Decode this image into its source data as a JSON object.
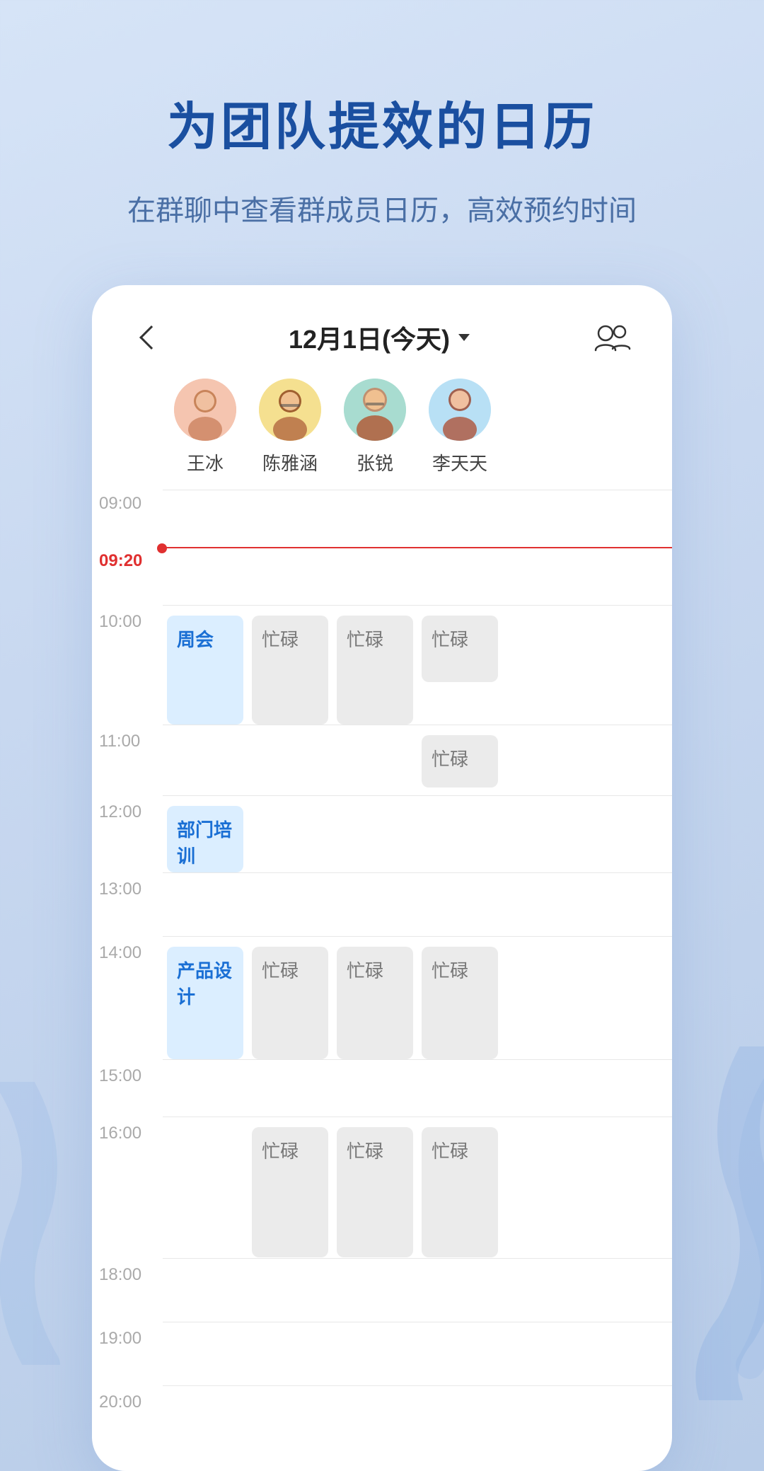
{
  "hero": {
    "title": "为团队提效的日历",
    "subtitle": "在群聊中查看群成员日历，高效预约时间"
  },
  "header": {
    "date": "12月1日(今天)",
    "back_label": "back",
    "group_label": "group"
  },
  "members": [
    {
      "name": "王冰",
      "avatar_color": "#f8d0c8",
      "avatar_label": "👩"
    },
    {
      "name": "陈雅涵",
      "avatar_color": "#f5e0a0",
      "avatar_label": "👩‍🦱"
    },
    {
      "name": "张锐",
      "avatar_color": "#c8e8e0",
      "avatar_label": "👨‍🦲"
    },
    {
      "name": "李天天",
      "avatar_color": "#c8e8f5",
      "avatar_label": "👩"
    }
  ],
  "schedule": {
    "time_slots": [
      {
        "time": "09:00",
        "is_current": false,
        "events": [
          null,
          null,
          null,
          null
        ]
      },
      {
        "time": "09:20",
        "is_current": true,
        "events": [
          null,
          null,
          null,
          null
        ]
      },
      {
        "time": "10:00",
        "is_current": false,
        "events": [
          {
            "label": "周会",
            "type": "blue",
            "span": 2
          },
          {
            "label": "忙碌",
            "type": "gray",
            "span": 2
          },
          {
            "label": "忙碌",
            "type": "gray",
            "span": 2
          },
          {
            "label": "忙碌",
            "type": "gray",
            "span": 2
          }
        ]
      },
      {
        "time": "11:00",
        "is_current": false,
        "events": [
          null,
          "cont",
          "cont",
          null
        ]
      },
      {
        "time": "12:00",
        "is_current": false,
        "events": [
          {
            "label": "部门培训",
            "type": "blue",
            "span": 1.5
          },
          null,
          null,
          {
            "label": "忙碌",
            "type": "gray",
            "span": 1
          }
        ]
      },
      {
        "time": "13:00",
        "is_current": false,
        "events": [
          null,
          null,
          null,
          null
        ]
      },
      {
        "time": "14:00",
        "is_current": false,
        "events": [
          {
            "label": "产品设计",
            "type": "blue",
            "span": 2
          },
          {
            "label": "忙碌",
            "type": "gray",
            "span": 2
          },
          {
            "label": "忙碌",
            "type": "gray",
            "span": 2
          },
          {
            "label": "忙碌",
            "type": "gray",
            "span": 2
          }
        ]
      },
      {
        "time": "15:00",
        "is_current": false,
        "events": [
          null,
          null,
          null,
          null
        ]
      },
      {
        "time": "16:00",
        "is_current": false,
        "events": [
          null,
          {
            "label": "忙碌",
            "type": "gray",
            "span": 2.5
          },
          {
            "label": "忙碌",
            "type": "gray",
            "span": 2.5
          },
          {
            "label": "忙碌",
            "type": "gray",
            "span": 2.5
          }
        ]
      },
      {
        "time": "18:00",
        "is_current": false,
        "events": [
          null,
          null,
          null,
          null
        ]
      },
      {
        "time": "19:00",
        "is_current": false,
        "events": [
          null,
          null,
          null,
          null
        ]
      },
      {
        "time": "20:00",
        "is_current": false,
        "events": [
          null,
          null,
          null,
          null
        ]
      }
    ]
  }
}
